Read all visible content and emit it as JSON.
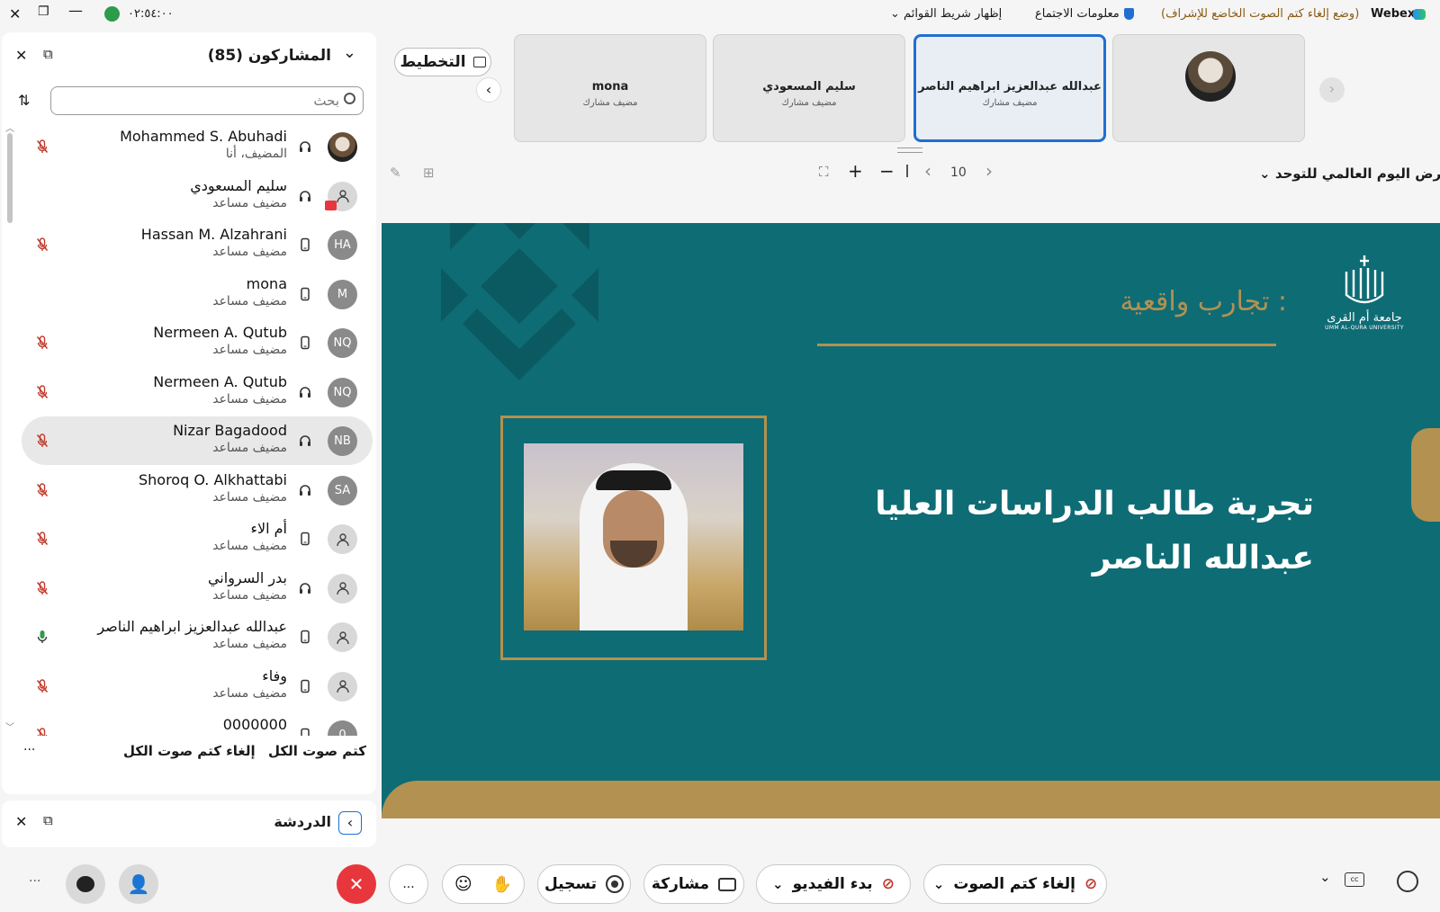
{
  "title_bar": {
    "app_name": "Webex",
    "mode_text": "(وضع إلغاء كتم الصوت الخاضع للإشراف)",
    "meeting_info": "معلومات الاجتماع",
    "show_menu_bar": "إظهار شريط القوائم",
    "timer": "٠٢:٥٤:٠٠"
  },
  "participants_panel": {
    "title": "المشاركون (85)",
    "search_placeholder": "بحث",
    "participants": [
      {
        "name": "Mohammed S. Abuhadi",
        "role": "المضيف، أنا",
        "initials": "",
        "device": "headset",
        "mic": "muted"
      },
      {
        "name": "سليم المسعودي",
        "role": "مضيف مساعد",
        "initials": "",
        "device": "headset",
        "mic": "none"
      },
      {
        "name": "Hassan M. Alzahrani",
        "role": "مضيف مساعد",
        "initials": "HA",
        "device": "phone",
        "mic": "muted"
      },
      {
        "name": "mona",
        "role": "مضيف مساعد",
        "initials": "M",
        "device": "phone",
        "mic": "none"
      },
      {
        "name": "Nermeen A. Qutub",
        "role": "مضيف مساعد",
        "initials": "NQ",
        "device": "phone",
        "mic": "muted"
      },
      {
        "name": "Nermeen A. Qutub",
        "role": "مضيف مساعد",
        "initials": "NQ",
        "device": "headset",
        "mic": "muted"
      },
      {
        "name": "Nizar Bagadood",
        "role": "مضيف مساعد",
        "initials": "NB",
        "device": "headset",
        "mic": "muted"
      },
      {
        "name": "Shoroq O. Alkhattabi",
        "role": "مضيف مساعد",
        "initials": "SA",
        "device": "headset",
        "mic": "muted"
      },
      {
        "name": "أم الاء",
        "role": "مضيف مساعد",
        "initials": "",
        "device": "phone",
        "mic": "muted"
      },
      {
        "name": "بدر السرواني",
        "role": "مضيف مساعد",
        "initials": "",
        "device": "headset",
        "mic": "muted"
      },
      {
        "name": "عبدالله عبدالعزيز ابراهيم الناصر",
        "role": "مضيف مساعد",
        "initials": "",
        "device": "phone",
        "mic": "active"
      },
      {
        "name": "وفاء",
        "role": "مضيف مساعد",
        "initials": "",
        "device": "phone",
        "mic": "muted"
      },
      {
        "name": "0000000",
        "role": "",
        "initials": "0",
        "device": "phone",
        "mic": "muted"
      }
    ],
    "mute_all": "كتم صوت الكل",
    "unmute_all": "إلغاء كتم صوت الكل",
    "more": "..."
  },
  "chat_panel": {
    "title": "الدردشة"
  },
  "video_strip": {
    "layout_button": "التخطيط",
    "tiles": [
      {
        "name": "mona",
        "role": "مضيف مشارك"
      },
      {
        "name": "سليم المسعودي",
        "role": "مضيف مشارك"
      },
      {
        "name": "عبدالله عبدالعزيز ابراهيم الناصر",
        "role": "مضيف مشارك"
      }
    ]
  },
  "share_toolbar": {
    "page_number": "10",
    "share_title": "عرض اليوم العالمي للتوحد"
  },
  "slide": {
    "header": "تجارب واقعية :",
    "line1": "تجربة طالب الدراسات العليا",
    "line2": "عبدالله الناصر",
    "logo_ar": "جامعة أم القرى",
    "logo_en": "UMM AL-QURA UNIVERSITY"
  },
  "controls": {
    "unmute": "إلغاء كتم الصوت",
    "start_video": "بدء الفيديو",
    "share": "مشاركة",
    "record": "تسجيل",
    "more": "...",
    "left_more": "..."
  },
  "colors": {
    "slide_bg": "#0e6c75",
    "gold": "#b39150",
    "active_tile_border": "#1f6fd1",
    "end_button": "#e8373c",
    "muted_mic": "#c0392b"
  }
}
